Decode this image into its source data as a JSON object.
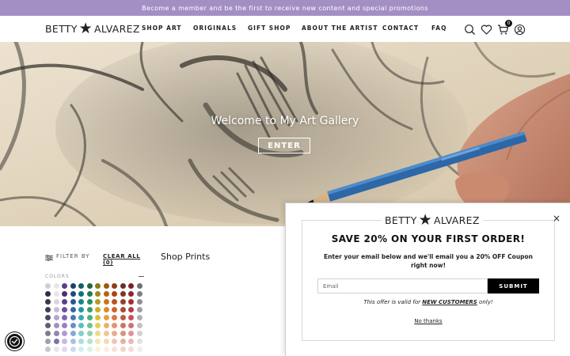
{
  "announcement": "Become a member and be the first to receive new content and special promotions",
  "brand": {
    "name_left": "BETTY",
    "name_right": "ALVAREZ",
    "star": "★"
  },
  "nav": {
    "items": [
      {
        "label": "SHOP ART"
      },
      {
        "label": "ORIGINALS"
      },
      {
        "label": "GIFT SHOP"
      },
      {
        "label": "ABOUT THE ARTIST"
      },
      {
        "label": "CONTACT"
      },
      {
        "label": "FAQ"
      }
    ]
  },
  "header_icons": {
    "search": "search-icon",
    "wishlist": "heart-icon",
    "cart": "cart-icon",
    "cart_count": "0",
    "account": "user-icon"
  },
  "hero": {
    "title": "Welcome to My Art Gallery",
    "button_label": "ENTER"
  },
  "filters": {
    "label": "FILTER BY",
    "clear_label": "CLEAR ALL (0)",
    "colors_label": "COLORS"
  },
  "shop_title": "Shop Prints",
  "swatch_columns": [
    [
      "#cfcfd3",
      "#2b3142",
      "#343a4a",
      "#3a4056",
      "#454b60",
      "#5b6175",
      "#7a7f90",
      "#9ea2b0",
      "#c7c9d1"
    ],
    [
      "#e6e6e8",
      "#e9e4ee",
      "#dcd3e6",
      "#c9bcd9",
      "#b5a6cc",
      "#a293bf",
      "#9384b4",
      "#8272a7",
      "#e9e6ef"
    ],
    [
      "#5a3f8a",
      "#4b2f73",
      "#5d3e8f",
      "#6f4ea2",
      "#8365b4",
      "#9a80c4",
      "#b29bd3",
      "#cab9e0",
      "#e2d7ee"
    ],
    [
      "#1f3e6b",
      "#244a7e",
      "#2b5892",
      "#3767a5",
      "#4979b5",
      "#6690c5",
      "#85a8d3",
      "#a8c2e1",
      "#cbdcee"
    ],
    [
      "#0f6165",
      "#127377",
      "#16868a",
      "#21999c",
      "#3aabaf",
      "#5cbec0",
      "#82d0d1",
      "#a9e0e0",
      "#d0efef"
    ],
    [
      "#1d6a43",
      "#237b4f",
      "#2b8e5c",
      "#37a06a",
      "#4cb27c",
      "#6bc391",
      "#91d3ab",
      "#b6e3c8",
      "#daf1e3"
    ],
    [
      "#8a7a1a",
      "#9c8b1c",
      "#b19e20",
      "#c7b226",
      "#d8c238",
      "#e2cf5c",
      "#ebdd86",
      "#f2e8ad",
      "#f8f3d6"
    ],
    [
      "#9b5a10",
      "#b16712",
      "#c87616",
      "#dc8a22",
      "#e69f45",
      "#ecb26b",
      "#f1c692",
      "#f5d9b8",
      "#fbeedc"
    ],
    [
      "#8e3d16",
      "#a4461a",
      "#bb5222",
      "#cf622f",
      "#da784d",
      "#e39171",
      "#eaab95",
      "#f1c6b8",
      "#f8e2da"
    ],
    [
      "#6e2f20",
      "#803725",
      "#94402b",
      "#a84b34",
      "#b95e48",
      "#c8775f",
      "#d6937e",
      "#e3b3a2",
      "#f0d5cb"
    ],
    [
      "#7a1f28",
      "#8f2630",
      "#a32d38",
      "#b73a45",
      "#c5525c",
      "#d26f78",
      "#de939a",
      "#e9b8bc",
      "#f4dcde"
    ],
    [
      "#6f6f73",
      "#7e7e82",
      "#8f8f93",
      "#a0a0a4",
      "#b1b1b4",
      "#c1c1c4",
      "#d1d1d3",
      "#e1e1e3",
      "#eeeeef"
    ]
  ],
  "popup": {
    "brand_left": "BETTY",
    "brand_right": "ALVAREZ",
    "heading": "SAVE 20% ON YOUR FIRST ORDER!",
    "subtext": "Enter your email below and we'll email you a 20% OFF Coupon right now!",
    "email_placeholder": "Email",
    "submit_label": "SUBMIT",
    "offer_prefix": "This offer is valid for ",
    "offer_highlight": "NEW CUSTOMERS",
    "offer_suffix": " only!",
    "decline_label": "No thanks",
    "close_label": "×"
  },
  "colors": {
    "announcement_bg": "#a48fc4",
    "button_dark": "#000000",
    "text": "#222222"
  }
}
